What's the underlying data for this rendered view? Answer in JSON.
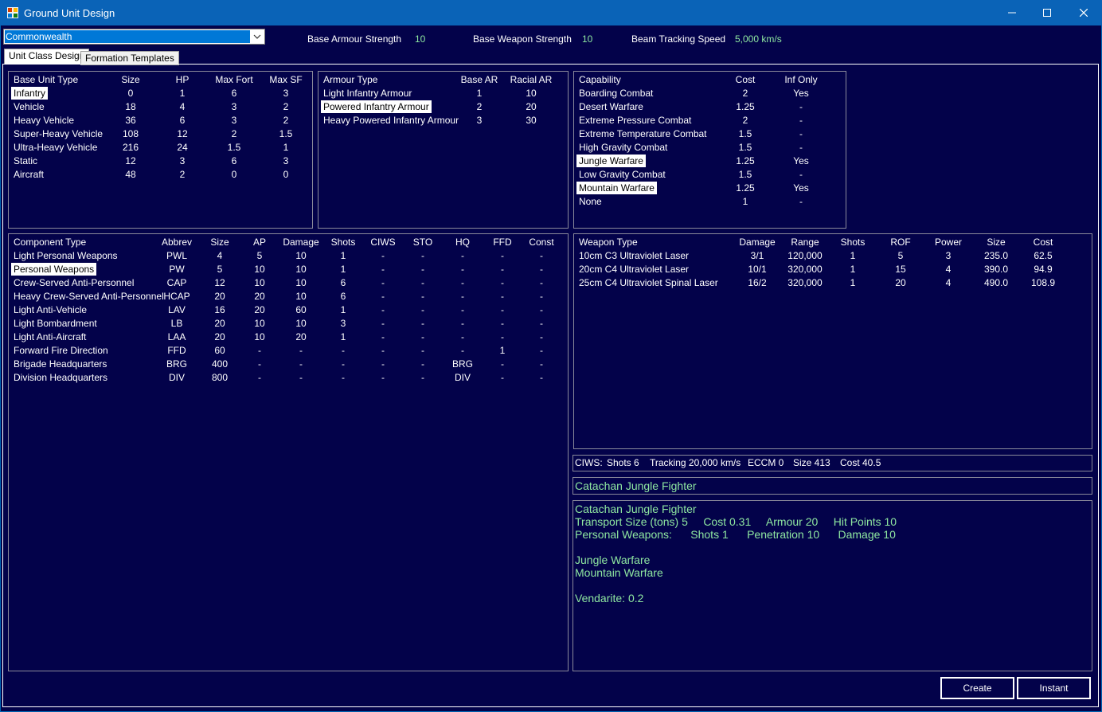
{
  "window": {
    "title": "Ground Unit Design"
  },
  "race_select": {
    "value": "Commonwealth"
  },
  "header": {
    "armour_label": "Base Armour Strength",
    "armour_value": "10",
    "weapon_label": "Base Weapon Strength",
    "weapon_value": "10",
    "tracking_label": "Beam Tracking Speed",
    "tracking_value": "5,000 km/s"
  },
  "tabs": [
    "Unit Class Design",
    "Formation Templates"
  ],
  "base_unit": {
    "headers": [
      "Base Unit Type",
      "Size",
      "HP",
      "Max Fort",
      "Max SF"
    ],
    "rows": [
      [
        "Infantry",
        "0",
        "1",
        "6",
        "3"
      ],
      [
        "Vehicle",
        "18",
        "4",
        "3",
        "2"
      ],
      [
        "Heavy Vehicle",
        "36",
        "6",
        "3",
        "2"
      ],
      [
        "Super-Heavy Vehicle",
        "108",
        "12",
        "2",
        "1.5"
      ],
      [
        "Ultra-Heavy Vehicle",
        "216",
        "24",
        "1.5",
        "1"
      ],
      [
        "Static",
        "12",
        "3",
        "6",
        "3"
      ],
      [
        "Aircraft",
        "48",
        "2",
        "0",
        "0"
      ]
    ],
    "selected": [
      0
    ]
  },
  "armour": {
    "headers": [
      "Armour Type",
      "Base AR",
      "Racial AR"
    ],
    "rows": [
      [
        "Light Infantry Armour",
        "1",
        "10"
      ],
      [
        "Powered Infantry Armour",
        "2",
        "20"
      ],
      [
        "Heavy Powered Infantry Armour",
        "3",
        "30"
      ]
    ],
    "selected": [
      1
    ]
  },
  "capability": {
    "headers": [
      "Capability",
      "Cost",
      "Inf Only"
    ],
    "rows": [
      [
        "Boarding Combat",
        "2",
        "Yes"
      ],
      [
        "Desert Warfare",
        "1.25",
        "-"
      ],
      [
        "Extreme Pressure Combat",
        "2",
        "-"
      ],
      [
        "Extreme Temperature Combat",
        "1.5",
        "-"
      ],
      [
        "High Gravity Combat",
        "1.5",
        "-"
      ],
      [
        "Jungle Warfare",
        "1.25",
        "Yes"
      ],
      [
        "Low Gravity Combat",
        "1.5",
        "-"
      ],
      [
        "Mountain Warfare",
        "1.25",
        "Yes"
      ],
      [
        "None",
        "1",
        "-"
      ]
    ],
    "selected": [
      5,
      7
    ]
  },
  "components": {
    "headers": [
      "Component Type",
      "Abbrev",
      "Size",
      "AP",
      "Damage",
      "Shots",
      "CIWS",
      "STO",
      "HQ",
      "FFD",
      "Const"
    ],
    "rows": [
      [
        "Light Personal Weapons",
        "PWL",
        "4",
        "5",
        "10",
        "1",
        "-",
        "-",
        "-",
        "-",
        "-"
      ],
      [
        "Personal Weapons",
        "PW",
        "5",
        "10",
        "10",
        "1",
        "-",
        "-",
        "-",
        "-",
        "-"
      ],
      [
        "Crew-Served Anti-Personnel",
        "CAP",
        "12",
        "10",
        "10",
        "6",
        "-",
        "-",
        "-",
        "-",
        "-"
      ],
      [
        "Heavy Crew-Served Anti-Personnel",
        "HCAP",
        "20",
        "20",
        "10",
        "6",
        "-",
        "-",
        "-",
        "-",
        "-"
      ],
      [
        "Light Anti-Vehicle",
        "LAV",
        "16",
        "20",
        "60",
        "1",
        "-",
        "-",
        "-",
        "-",
        "-"
      ],
      [
        "Light Bombardment",
        "LB",
        "20",
        "10",
        "10",
        "3",
        "-",
        "-",
        "-",
        "-",
        "-"
      ],
      [
        "Light Anti-Aircraft",
        "LAA",
        "20",
        "10",
        "20",
        "1",
        "-",
        "-",
        "-",
        "-",
        "-"
      ],
      [
        "Forward Fire Direction",
        "FFD",
        "60",
        "-",
        "-",
        "-",
        "-",
        "-",
        "-",
        "1",
        "-"
      ],
      [
        "Brigade Headquarters",
        "BRG",
        "400",
        "-",
        "-",
        "-",
        "-",
        "-",
        "BRG",
        "-",
        "-"
      ],
      [
        "Division Headquarters",
        "DIV",
        "800",
        "-",
        "-",
        "-",
        "-",
        "-",
        "DIV",
        "-",
        "-"
      ]
    ],
    "selected": [
      1
    ]
  },
  "weapons": {
    "headers": [
      "Weapon Type",
      "Damage",
      "Range",
      "Shots",
      "ROF",
      "Power",
      "Size",
      "Cost"
    ],
    "rows": [
      [
        "10cm C3 Ultraviolet Laser",
        "3/1",
        "120,000",
        "1",
        "5",
        "3",
        "235.0",
        "62.5"
      ],
      [
        "20cm C4 Ultraviolet Laser",
        "10/1",
        "320,000",
        "1",
        "15",
        "4",
        "390.0",
        "94.9"
      ],
      [
        "25cm C4 Ultraviolet Spinal Laser",
        "16/2",
        "320,000",
        "1",
        "20",
        "4",
        "490.0",
        "108.9"
      ]
    ],
    "selected": []
  },
  "ciws": {
    "label": "CIWS:",
    "shots": "Shots 6",
    "tracking": "Tracking 20,000 km/s",
    "eccm": "ECCM 0",
    "size": "Size 413",
    "cost": "Cost 40.5"
  },
  "unit_name": "Catachan Jungle Fighter",
  "summary": {
    "lines": [
      "Catachan Jungle Fighter",
      "Transport Size (tons) 5     Cost 0.31     Armour 20     Hit Points 10",
      "Personal Weapons:      Shots 1      Penetration 10      Damage 10",
      "",
      "Jungle Warfare",
      "Mountain Warfare",
      "",
      "Vendarite: 0.2"
    ]
  },
  "buttons": {
    "create": "Create",
    "instant": "Instant"
  }
}
